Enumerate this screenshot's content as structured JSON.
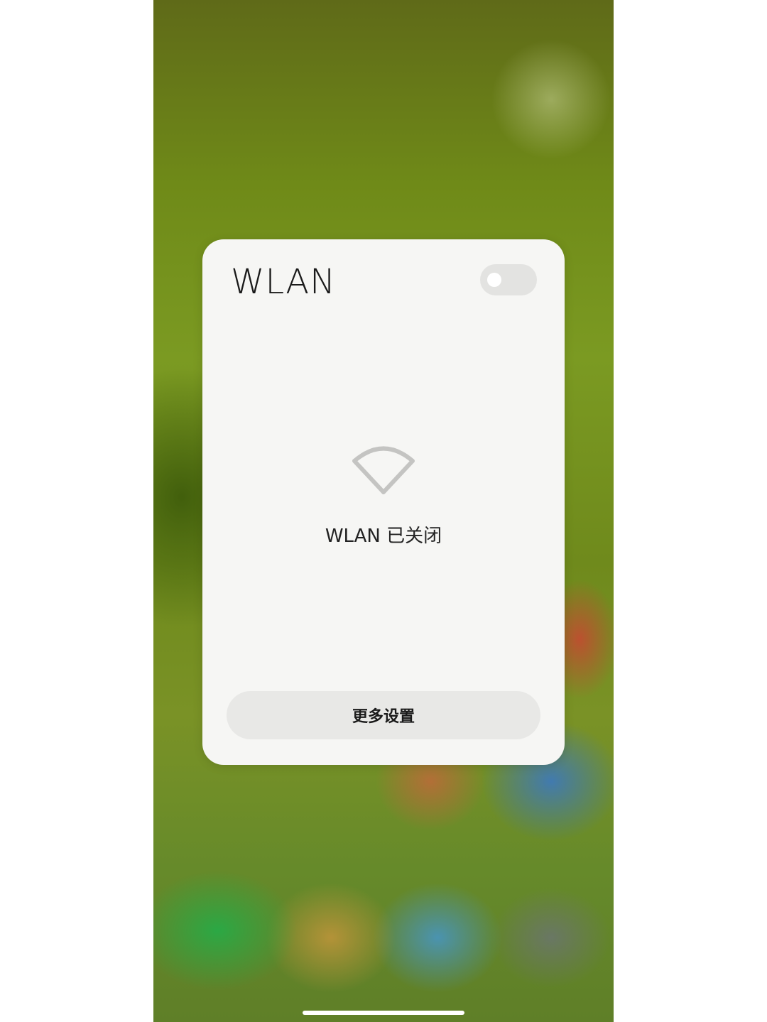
{
  "wlan_panel": {
    "title": "WLAN",
    "toggle_state": "off",
    "icon": "wifi-icon",
    "status_text": "WLAN 已关闭",
    "more_settings_label": "更多设置"
  },
  "colors": {
    "card_background": "#f6f6f4",
    "toggle_off": "#e3e3e1",
    "button_background": "#e8e8e6"
  }
}
